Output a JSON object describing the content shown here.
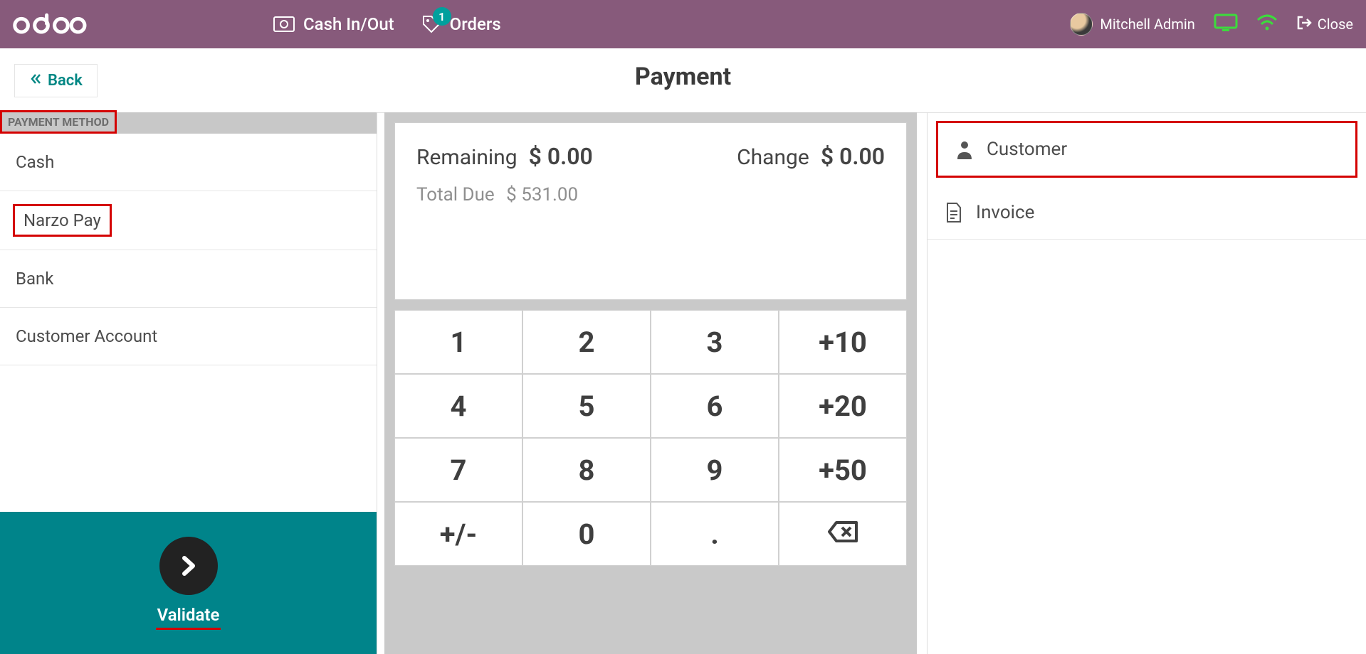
{
  "header": {
    "cash_in_out_label": "Cash In/Out",
    "orders_label": "Orders",
    "orders_badge": "1",
    "user_name": "Mitchell Admin",
    "close_label": "Close"
  },
  "subheader": {
    "back_label": "Back",
    "page_title": "Payment"
  },
  "methods": {
    "header": "PAYMENT METHOD",
    "items": [
      {
        "label": "Cash"
      },
      {
        "label": "Narzo Pay"
      },
      {
        "label": "Bank"
      },
      {
        "label": "Customer Account"
      }
    ],
    "validate_label": "Validate"
  },
  "center": {
    "remaining_label": "Remaining",
    "remaining_value": "$ 0.00",
    "change_label": "Change",
    "change_value": "$ 0.00",
    "total_due_label": "Total Due",
    "total_due_value": "$ 531.00",
    "keys": [
      "1",
      "2",
      "3",
      "+10",
      "4",
      "5",
      "6",
      "+20",
      "7",
      "8",
      "9",
      "+50",
      "+/-",
      "0",
      ".",
      "⌫"
    ]
  },
  "right": {
    "customer_label": "Customer",
    "invoice_label": "Invoice"
  }
}
